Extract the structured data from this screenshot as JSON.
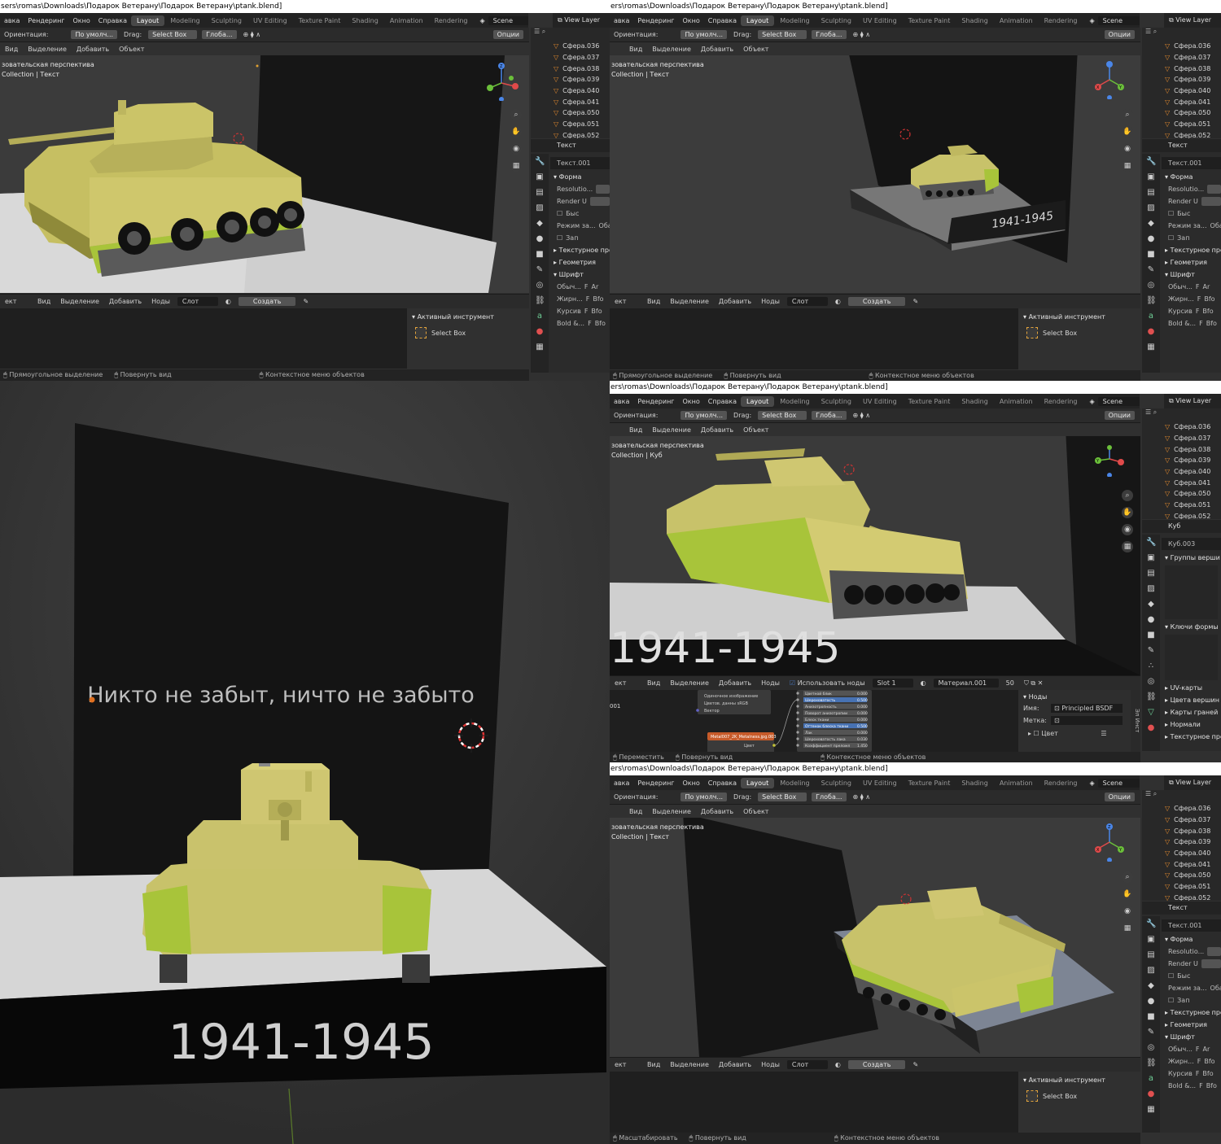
{
  "window": {
    "title_path": "ers\\romas\\Downloads\\Подарок Ветерану\\Подарок Ветерану\\ptank.blend]",
    "title_path_short": "sers\\romas\\Downloads\\Подарок Ветерану\\Подарок Ветерану\\ptank.blend]"
  },
  "menu": [
    "авка",
    "Рендеринг",
    "Окно",
    "Справка"
  ],
  "workspaces": [
    "Layout",
    "Modeling",
    "Sculpting",
    "UV Editing",
    "Texture Paint",
    "Shading",
    "Animation",
    "Rendering"
  ],
  "scene": "Scene",
  "view_layer": "View Layer",
  "toolbar": {
    "orientation_label": "Ориентация:",
    "orientation_value": "По умолч...",
    "drag_label": "Drag:",
    "drag_value": "Select Box",
    "transform_value": "Глоба...",
    "options": "Опции"
  },
  "viewport_header": [
    "Вид",
    "Выделение",
    "Добавить",
    "Объект"
  ],
  "viewport": {
    "perspective": "зовательская перспектива",
    "context_text": "Collection | Текст",
    "context_cube": "Collection | Куб",
    "years": "1941-1945",
    "slogan": "Никто не забыт, ничто не забыто"
  },
  "gizmo": {
    "x": "X",
    "y": "Y",
    "z": "Z"
  },
  "outliner_items": [
    "Сфера.036",
    "Сфера.037",
    "Сфера.038",
    "Сфера.039",
    "Сфера.040",
    "Сфера.041",
    "Сфера.050",
    "Сфера.051",
    "Сфера.052"
  ],
  "properties_text": {
    "object": "Текст",
    "data": "Текст.001",
    "section_shape": "Форма",
    "resolution": "Resolutio...",
    "render_u": "Render U",
    "fast": "Быс",
    "fill_mode": "Режим за...",
    "fill_value": "Оба(",
    "fill2": "Зап",
    "texture_space": "Текстурное про",
    "geometry": "Геометрия",
    "font": "Шрифт",
    "regular": "Обыч...",
    "bold": "Жирн...",
    "italic": "Курсив",
    "bold_italic": "Bold &...",
    "font_name": "Ar",
    "font_bfo": "Bfo"
  },
  "properties_cube": {
    "object": "Куб",
    "data": "Куб.003",
    "vertex_groups": "Группы верши",
    "shape_keys": "Ключи формы",
    "uv_maps": "UV-карты",
    "vertex_colors": "Цвета вершин",
    "face_maps": "Карты граней",
    "normals": "Нормали",
    "texture_space": "Текстурное про"
  },
  "node_header": {
    "object": "ект",
    "items": [
      "Вид",
      "Выделение",
      "Добавить",
      "Ноды"
    ],
    "slot": "Слот",
    "create": "Создать",
    "use_nodes": "Использовать ноды",
    "slot1": "Slot 1",
    "material": "Материал.001",
    "users": "50"
  },
  "node_sidebar": {
    "section": "Ноды",
    "name_label": "Имя:",
    "name_value": "Principled BSDF",
    "label_label": "Метка:",
    "color": "Цвет",
    "tab1": "Инст",
    "tab2": "Эл"
  },
  "nodes": {
    "image_texture_rows": [
      "Одиночное изображение",
      "Цветов. данны  sRGB",
      "Вектор"
    ],
    "metal_image": "Metal007_2K_Metalness.jpg.003",
    "metal_out": "Цвет",
    "bsdf_rows": [
      {
        "label": "Цветной блик",
        "value": "0.000"
      },
      {
        "label": "Шероховатость",
        "value": "0.500"
      },
      {
        "label": "Анизотропность",
        "value": "0.000"
      },
      {
        "label": "Поворот анизотропии",
        "value": "0.000"
      },
      {
        "label": "Блеск ткани",
        "value": "0.000"
      },
      {
        "label": "Оттенок блеска ткани",
        "value": "0.500"
      },
      {
        "label": "Лак",
        "value": "0.000"
      },
      {
        "label": "Шероховатость лака",
        "value": "0.030"
      },
      {
        "label": "Коэффициент преломл",
        "value": "1.450"
      }
    ],
    "bsdf_label": "001"
  },
  "active_tool": {
    "title": "Активный инструмент",
    "name": "Select Box"
  },
  "status": {
    "box_select": "Прямоугольное выделение",
    "rotate": "Повернуть вид",
    "context_menu": "Контекстное меню объектов",
    "move": "Переместить",
    "scale": "Масштабировать"
  },
  "colors": {
    "tank_body": "#c9c26a",
    "tank_dark": "#8f8a3a",
    "tank_green": "#a8c43a",
    "ui_bg": "#303030",
    "header_bg": "#232323",
    "accent": "#4772b3",
    "orange": "#e48a2e"
  }
}
